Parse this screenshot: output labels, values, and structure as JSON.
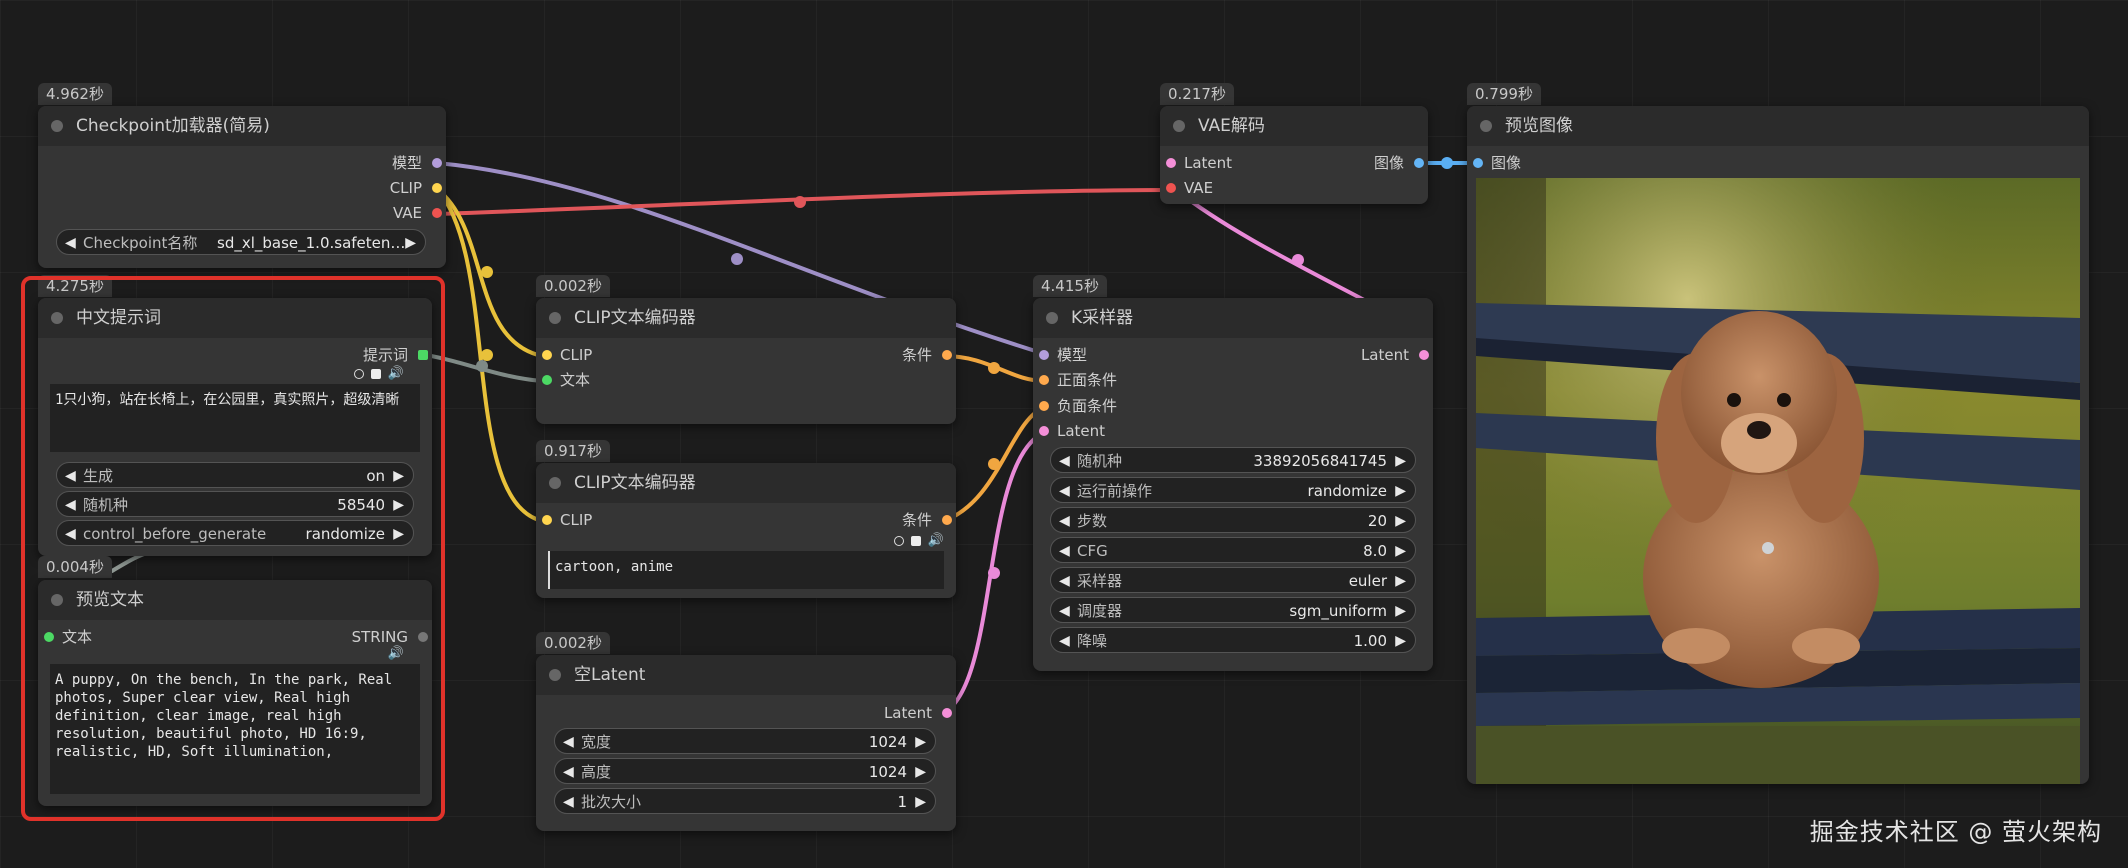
{
  "nodes": {
    "checkpoint": {
      "time": "4.962秒",
      "title": "Checkpoint加载器(简易)",
      "outputs": [
        "模型",
        "CLIP",
        "VAE"
      ],
      "widget_label": "Checkpoint名称",
      "widget_value": "sd_xl_base_1.0.safeten…"
    },
    "vae_decode": {
      "time": "0.217秒",
      "title": "VAE解码",
      "inputs": [
        "Latent",
        "VAE"
      ],
      "output": "图像"
    },
    "preview_image": {
      "time": "0.799秒",
      "title": "预览图像",
      "input": "图像"
    },
    "cn_prompt": {
      "time": "4.275秒",
      "title": "中文提示词",
      "output": "提示词",
      "text": "1只小狗，站在长椅上，在公园里，真实照片，超级清晰",
      "widgets": [
        {
          "label": "生成",
          "value": "on"
        },
        {
          "label": "随机种",
          "value": "58540"
        },
        {
          "label": "control_before_generate",
          "value": "randomize"
        }
      ]
    },
    "preview_text": {
      "time": "0.004秒",
      "title": "预览文本",
      "input": "文本",
      "output": "STRING",
      "text": "A puppy, On the bench, In the park, Real photos, Super clear view, Real high definition, clear image, real high resolution, beautiful photo, HD 16:9, realistic, HD, Soft illumination,"
    },
    "clip_pos": {
      "time": "0.002秒",
      "title": "CLIP文本编码器",
      "inputs": [
        "CLIP",
        "文本"
      ],
      "output": "条件"
    },
    "clip_neg": {
      "time": "0.917秒",
      "title": "CLIP文本编码器",
      "input": "CLIP",
      "output": "条件",
      "text": "cartoon, anime"
    },
    "empty_latent": {
      "time": "0.002秒",
      "title": "空Latent",
      "output": "Latent",
      "widgets": [
        {
          "label": "宽度",
          "value": "1024"
        },
        {
          "label": "高度",
          "value": "1024"
        },
        {
          "label": "批次大小",
          "value": "1"
        }
      ]
    },
    "ksampler": {
      "time": "4.415秒",
      "title": "K采样器",
      "inputs": [
        "模型",
        "正面条件",
        "负面条件",
        "Latent"
      ],
      "output": "Latent",
      "widgets": [
        {
          "label": "随机种",
          "value": "33892056841745"
        },
        {
          "label": "运行前操作",
          "value": "randomize"
        },
        {
          "label": "步数",
          "value": "20"
        },
        {
          "label": "CFG",
          "value": "8.0"
        },
        {
          "label": "采样器",
          "value": "euler"
        },
        {
          "label": "调度器",
          "value": "sgm_uniform"
        },
        {
          "label": "降噪",
          "value": "1.00"
        }
      ]
    }
  },
  "port_colors": {
    "model": "#b39ddb",
    "clip": "#ffd54f",
    "vae": "#ef5350",
    "conditioning": "#ffa94d",
    "latent": "#f48fd8",
    "image": "#64b5f6",
    "string": "#4cd964"
  },
  "watermark": "掘金技术社区 @ 萤火架构"
}
